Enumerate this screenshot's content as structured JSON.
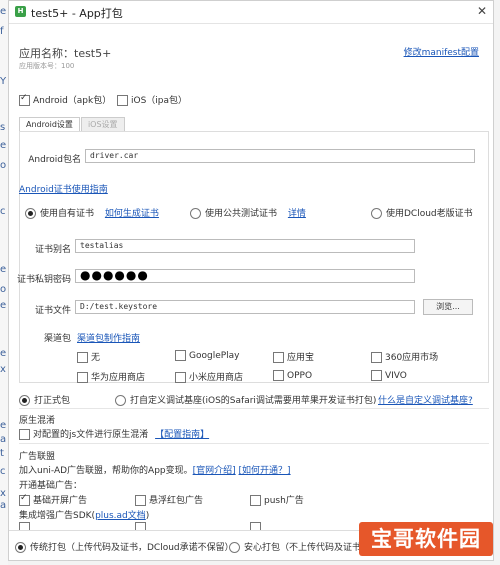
{
  "window": {
    "title": "test5+ - App打包",
    "icon_label": "H",
    "close_glyph": "✕"
  },
  "app": {
    "name_label": "应用名称：test5+",
    "version_label": "应用版本号：100",
    "manifest_link": "修改manifest配置"
  },
  "platforms": [
    {
      "label": "Android（apk包）",
      "checked": true
    },
    {
      "label": "iOS（ipa包）",
      "checked": false
    }
  ],
  "tabs": [
    {
      "label": "Android设置",
      "active": true
    },
    {
      "label": "iOS设置",
      "active": false
    }
  ],
  "android": {
    "package_label": "Android包名",
    "package_value": "driver.car",
    "cert_guide_link": "Android证书使用指南",
    "cert_options": [
      {
        "label": "使用自有证书",
        "checked": true,
        "link": "如何生成证书"
      },
      {
        "label": "使用公共测试证书",
        "checked": false,
        "link": "详情"
      },
      {
        "label": "使用DCloud老版证书",
        "checked": false,
        "link": ""
      }
    ],
    "alias_label": "证书别名",
    "alias_value": "testalias",
    "pwd_label": "证书私钥密码",
    "pwd_value": "●●●●●●",
    "file_label": "证书文件",
    "file_value": "D:/test.keystore",
    "browse_label": "浏览...",
    "channel_label": "渠道包",
    "channel_link": "渠道包制作指南",
    "channels": [
      {
        "label": "无",
        "checked": false
      },
      {
        "label": "GooglePlay",
        "checked": false
      },
      {
        "label": "应用宝",
        "checked": false
      },
      {
        "label": "360应用市场",
        "checked": false
      },
      {
        "label": "华为应用商店",
        "checked": false
      },
      {
        "label": "小米应用商店",
        "checked": false
      },
      {
        "label": "OPPO",
        "checked": false
      },
      {
        "label": "VIVO",
        "checked": false
      }
    ]
  },
  "build_type": {
    "formal_label": "打正式包",
    "formal_checked": true,
    "custom_label": "打自定义调试基座(iOS的Safari调试需要用苹果开发证书打包)",
    "custom_checked": false,
    "custom_link": "什么是自定义调试基座?"
  },
  "native_obfuscation": {
    "section": "原生混淆",
    "option_label": "对配置的js文件进行原生混淆",
    "option_link": "【配置指南】"
  },
  "ads": {
    "section": "广告联盟",
    "join_text": "加入uni-AD广告联盟，帮助你的App变现。",
    "intro_link": "[官网介绍]",
    "open_link": "[如何开通？]",
    "basic_label": "开通基础广告：",
    "basic_options": [
      {
        "label": "基础开屏广告",
        "checked": true
      },
      {
        "label": "悬浮红包广告",
        "checked": false
      },
      {
        "label": "push广告",
        "checked": false
      }
    ],
    "enhanced_label_prefix": "集成增强广告SDK(",
    "enhanced_link": "plus.ad文档",
    "enhanced_label_suffix": ")"
  },
  "pack_mode": [
    {
      "label": "传统打包（上传代码及证书，DCloud承诺不保留）",
      "checked": true
    },
    {
      "label": "安心打包（不上传代码及证书",
      "checked": false
    }
  ],
  "watermark": "宝哥软件园",
  "background_chars": [
    "e",
    "f",
    "Y",
    "s",
    "e",
    "o",
    "c",
    "e",
    "o",
    "e",
    "e",
    "x",
    "e",
    "a",
    "t",
    "c",
    "x",
    "a"
  ]
}
